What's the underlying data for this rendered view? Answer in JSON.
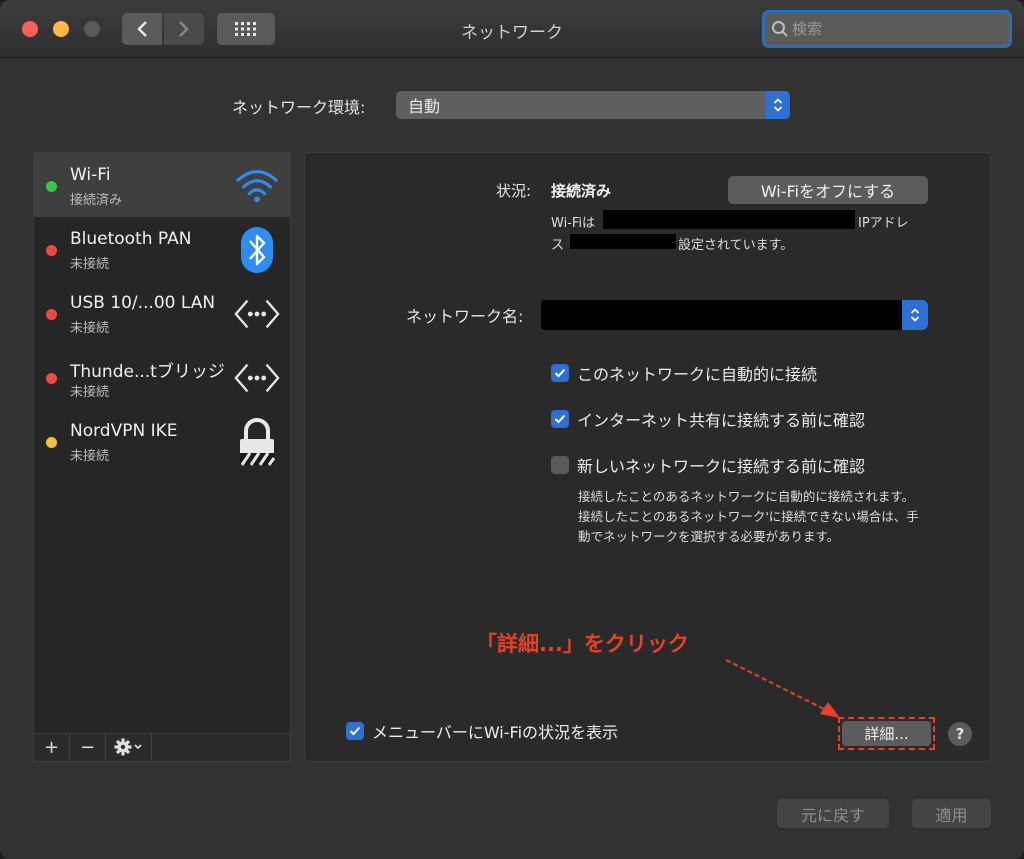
{
  "window": {
    "title": "ネットワーク"
  },
  "search": {
    "placeholder": "検索"
  },
  "location": {
    "label": "ネットワーク環境:",
    "value": "自動"
  },
  "services": [
    {
      "name": "Wi-Fi",
      "status": "接続済み",
      "dot_color": "#3cc64a",
      "icon": "wifi-icon",
      "selected": true
    },
    {
      "name": "Bluetooth PAN",
      "status": "未接続",
      "dot_color": "#f24a3e",
      "icon": "bluetooth-icon",
      "selected": false
    },
    {
      "name": "USB 10/...00 LAN",
      "status": "未接続",
      "dot_color": "#f24a3e",
      "icon": "ethernet-icon",
      "selected": false
    },
    {
      "name": "Thunde...tブリッジ",
      "status": "未接続",
      "dot_color": "#f24a3e",
      "icon": "ethernet-icon",
      "selected": false
    },
    {
      "name": "NordVPN IKE",
      "status": "未接続",
      "dot_color": "#f5c038",
      "icon": "vpn-lock-icon",
      "selected": false
    }
  ],
  "sidebar_footer": {
    "add": "+",
    "remove": "−",
    "gear": "gear-icon"
  },
  "detail": {
    "status_label": "状況:",
    "status_value": "接続済み",
    "wifi_off_button": "Wi-Fiをオフにする",
    "desc_line1_prefix": "Wi-Fiは",
    "desc_line1_suffix": "IPアドレ",
    "desc_line2_prefix": "ス",
    "desc_line2_suffix": "設定されています。",
    "network_name_label": "ネットワーク名:",
    "auto_join": {
      "label": "このネットワークに自動的に接続",
      "checked": true
    },
    "personal_hotspot": {
      "label": "インターネット共有に接続する前に確認",
      "checked": true
    },
    "ask_new": {
      "label": "新しいネットワークに接続する前に確認",
      "checked": false
    },
    "help_text": "接続したことのあるネットワークに自動的に接続されます。接続したことのあるネットワーク'に接続できない場合は、手動でネットワークを選択する必要があります。",
    "show_in_menubar": {
      "label": "メニューバーにWi-Fiの状況を表示",
      "checked": true
    },
    "advanced_button": "詳細...",
    "help_button": "?"
  },
  "annotation": {
    "text": "「詳細...」をクリック",
    "color": "#e8402a"
  },
  "buttons": {
    "revert": "元に戻す",
    "apply": "適用"
  },
  "colors": {
    "accent": "#2f6fd6",
    "annotation": "#e8402a"
  }
}
